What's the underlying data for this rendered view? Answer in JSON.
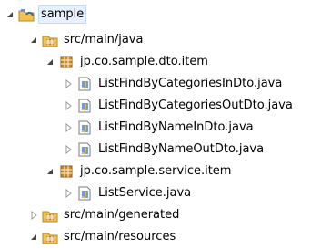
{
  "tree": {
    "project": {
      "label": "sample"
    },
    "src_main_java": {
      "label": "src/main/java"
    },
    "pkg_dto_item": {
      "label": "jp.co.sample.dto.item"
    },
    "files_dto": [
      {
        "label": "ListFindByCategoriesInDto.java"
      },
      {
        "label": "ListFindByCategoriesOutDto.java"
      },
      {
        "label": "ListFindByNameInDto.java"
      },
      {
        "label": "ListFindByNameOutDto.java"
      }
    ],
    "pkg_service_item": {
      "label": "jp.co.sample.service.item"
    },
    "file_service": {
      "label": "ListService.java"
    },
    "src_main_generated": {
      "label": "src/main/generated"
    },
    "src_main_resources": {
      "label": "src/main/resources"
    }
  },
  "colors": {
    "expanded_triangle": "#444444",
    "collapsed_triangle": "#9a9a9a",
    "folder_yellow": "#e8b43a",
    "package_brown": "#b7832a",
    "java_blue": "#3c6fb6"
  }
}
